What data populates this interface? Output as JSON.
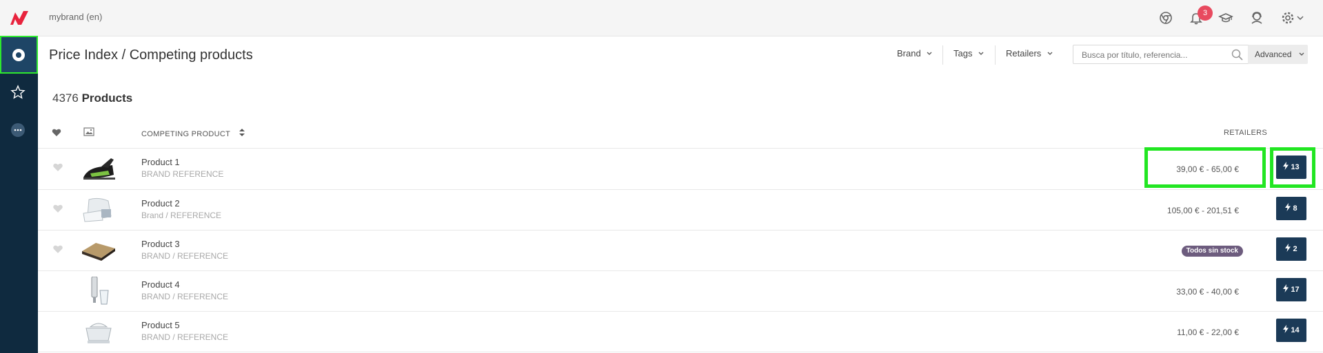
{
  "header": {
    "brand_name": "mybrand (en)",
    "notification_count": "3"
  },
  "page": {
    "title": "Price Index / Competing products",
    "filters": [
      "Brand",
      "Tags",
      "Retailers"
    ],
    "search_placeholder": "Busca por título, referencia...",
    "advanced_label": "Advanced",
    "count_number": "4376",
    "count_label": "Products"
  },
  "table": {
    "col_product": "COMPETING PRODUCT",
    "col_retailers": "RETAILERS",
    "rows": [
      {
        "name": "Product 1",
        "reference": "BRAND REFERENCE",
        "price": "39,00 € - 65,00 €",
        "retailers": "13",
        "favorite": true
      },
      {
        "name": "Product 2",
        "reference": "Brand / REFERENCE",
        "price": "105,00 € - 201,51 €",
        "retailers": "8",
        "favorite": true
      },
      {
        "name": "Product 3",
        "reference": "BRAND / REFERENCE",
        "status": "Todos sin stock",
        "retailers": "2",
        "favorite": true
      },
      {
        "name": "Product 4",
        "reference": "BRAND / REFERENCE",
        "price": "33,00 € - 40,00 €",
        "retailers": "17",
        "favorite": false
      },
      {
        "name": "Product 5",
        "reference": "BRAND / REFERENCE",
        "price": "11,00 € - 22,00 €",
        "retailers": "14",
        "favorite": false
      }
    ]
  },
  "colors": {
    "sidebar": "#0f2a3f",
    "primary_button": "#1b3a57",
    "badge": "#e84a5f",
    "highlight": "#22e622",
    "status_badge": "#6d5c7e"
  },
  "icons": [
    "logo-icon",
    "chrome-icon",
    "bell-icon",
    "graduation-cap-icon",
    "support-agent-icon",
    "gear-icon",
    "chevron-down-icon",
    "target-icon",
    "star-icon",
    "more-icon",
    "search-icon",
    "heart-icon",
    "image-icon",
    "sort-icon",
    "bolt-icon"
  ]
}
